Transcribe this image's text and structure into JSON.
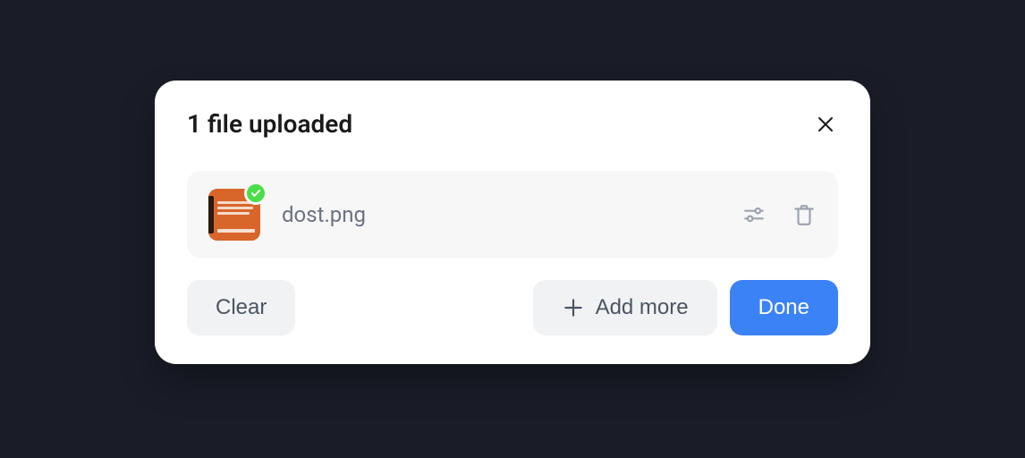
{
  "header": {
    "title": "1 file uploaded"
  },
  "file": {
    "name": "dost.png"
  },
  "footer": {
    "clear_label": "Clear",
    "add_more_label": "Add more",
    "done_label": "Done"
  }
}
